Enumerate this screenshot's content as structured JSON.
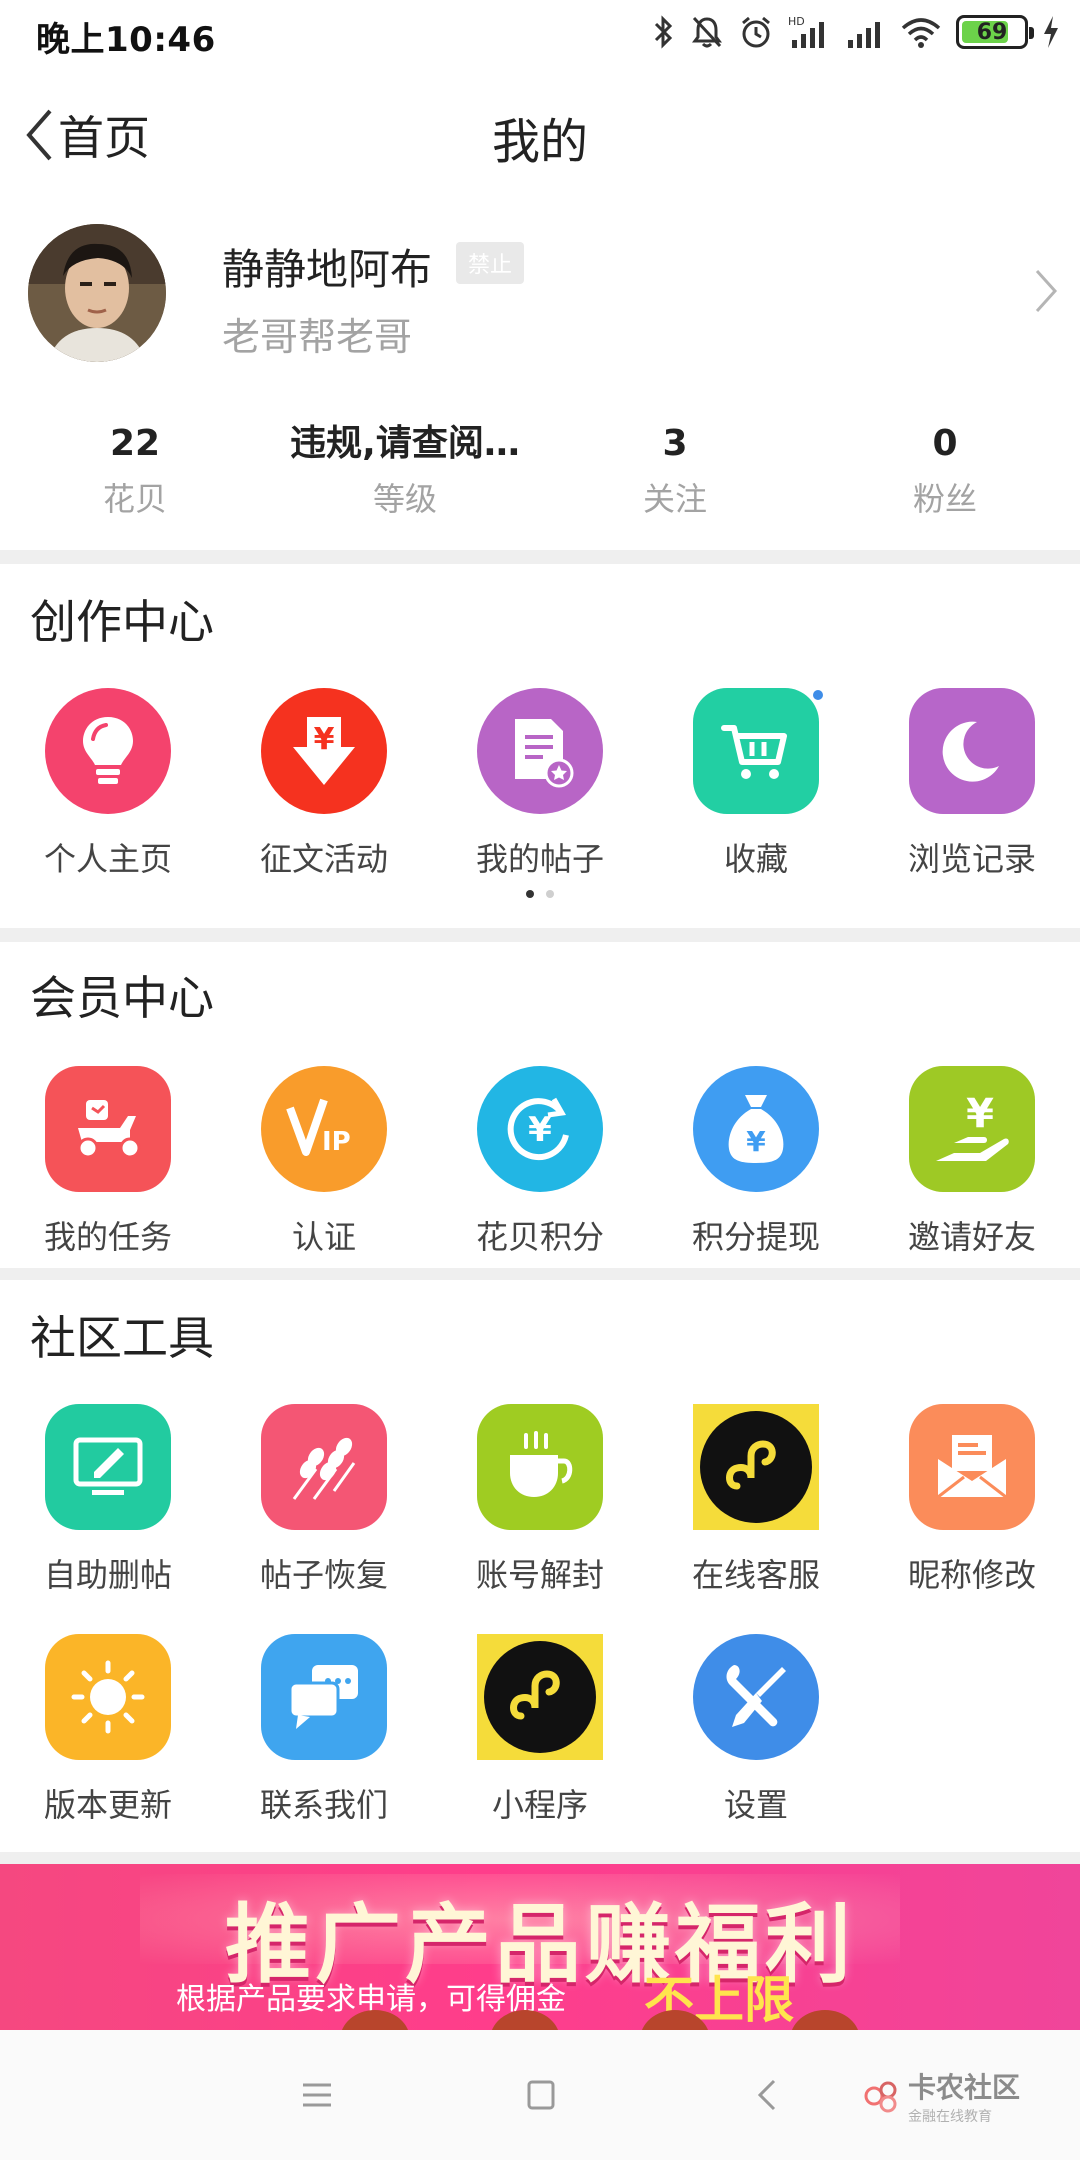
{
  "status_bar": {
    "time": "晚上10:46",
    "battery": "69",
    "network": "HD"
  },
  "nav": {
    "back_label": "首页",
    "title": "我的"
  },
  "profile": {
    "username": "静静地阿布",
    "badge": "禁止",
    "signature": "老哥帮老哥"
  },
  "stats": [
    {
      "value": "22",
      "label": "花贝"
    },
    {
      "value": "违规,请查阅…",
      "label": "等级"
    },
    {
      "value": "3",
      "label": "关注"
    },
    {
      "value": "0",
      "label": "粉丝"
    }
  ],
  "creation_center": {
    "title": "创作中心",
    "items": [
      {
        "label": "个人主页",
        "icon": "lightbulb-icon",
        "color": "#f4436d"
      },
      {
        "label": "征文活动",
        "icon": "yuan-download-icon",
        "color": "#f5321f"
      },
      {
        "label": "我的帖子",
        "icon": "document-star-icon",
        "color": "#b865c6"
      },
      {
        "label": "收藏",
        "icon": "shopping-cart-icon",
        "color": "#22cfa3"
      },
      {
        "label": "浏览记录",
        "icon": "moon-icon",
        "color": "#b766c9"
      }
    ]
  },
  "member_center": {
    "title": "会员中心",
    "items": [
      {
        "label": "我的任务",
        "icon": "scooter-icon",
        "color": "#f55358"
      },
      {
        "label": "认证",
        "icon": "vip-icon",
        "color": "#f99c2b"
      },
      {
        "label": "花贝积分",
        "icon": "yuan-refresh-icon",
        "color": "#22b6e4"
      },
      {
        "label": "积分提现",
        "icon": "money-bag-icon",
        "color": "#3f9df2"
      },
      {
        "label": "邀请好友",
        "icon": "yuan-hand-icon",
        "color": "#9ec925"
      }
    ]
  },
  "community_tools": {
    "title": "社区工具",
    "items": [
      {
        "label": "自助删帖",
        "icon": "monitor-edit-icon",
        "color": "#22cba0"
      },
      {
        "label": "帖子恢复",
        "icon": "skewers-icon",
        "color": "#f45674"
      },
      {
        "label": "账号解封",
        "icon": "coffee-cup-icon",
        "color": "#9fcc22"
      },
      {
        "label": "在线客服",
        "icon": "mini-program-icon",
        "color": "#f5dc3a"
      },
      {
        "label": "昵称修改",
        "icon": "mail-icon",
        "color": "#fb8c5a"
      },
      {
        "label": "版本更新",
        "icon": "sun-icon",
        "color": "#fbb528"
      },
      {
        "label": "联系我们",
        "icon": "chat-icon",
        "color": "#3fa5ef"
      },
      {
        "label": "小程序",
        "icon": "mini-program-icon",
        "color": "#f5dc3a"
      },
      {
        "label": "设置",
        "icon": "wrench-screwdriver-icon",
        "color": "#3f8de8"
      }
    ]
  },
  "banner": {
    "title": "推广产品赚福利",
    "subtitle": "根据产品要求申请，可得佣金",
    "emphasis": "不上限"
  },
  "watermark": {
    "text": "卡农社区",
    "sub": "金融在线教育"
  }
}
